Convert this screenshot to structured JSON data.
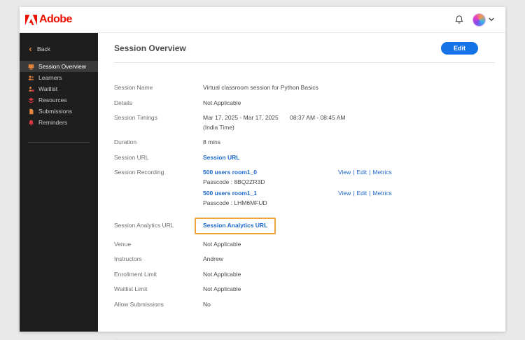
{
  "colors": {
    "adobe_red": "#EB1000",
    "link_blue": "#1B66C9",
    "button_blue": "#1473E6",
    "highlight_orange": "#F2A33C",
    "sidebar_bg": "#1E1E1E",
    "sidebar_active_bg": "#3A3A3A"
  },
  "topbar": {
    "logo_text": "Adobe"
  },
  "sidebar": {
    "back_label": "Back",
    "items": [
      {
        "label": "Session Overview"
      },
      {
        "label": "Learners"
      },
      {
        "label": "Waitlist"
      },
      {
        "label": "Resources"
      },
      {
        "label": "Submissions"
      },
      {
        "label": "Reminders"
      }
    ]
  },
  "main": {
    "title": "Session Overview",
    "edit_button_label": "Edit",
    "fields": {
      "session_name": {
        "label": "Session Name",
        "value": "Virtual classroom session for Python Basics"
      },
      "details": {
        "label": "Details",
        "value": "Not Applicable"
      },
      "session_timings": {
        "label": "Session Timings",
        "dates": "Mar 17, 2025 - Mar 17, 2025",
        "times": "08:37 AM - 08:45 AM",
        "timezone": "(India Time)"
      },
      "duration": {
        "label": "Duration",
        "value": "8 mins"
      },
      "session_url": {
        "label": "Session URL",
        "link_text": "Session URL"
      },
      "session_recording": {
        "label": "Session Recording",
        "separator": "|",
        "items": [
          {
            "link_text": "500 users room1_0",
            "passcode": "Passcode : 8BQ2ZR3D",
            "actions": [
              "View",
              "Edit",
              "Metrics"
            ]
          },
          {
            "link_text": "500 users room1_1",
            "passcode": "Passcode : LHM6MFUD",
            "actions": [
              "View",
              "Edit",
              "Metrics"
            ]
          }
        ]
      },
      "session_analytics": {
        "label": "Session Analytics URL",
        "link_text": "Session Analytics URL"
      },
      "venue": {
        "label": "Venue",
        "value": "Not Applicable"
      },
      "instructors": {
        "label": "Instructors",
        "value": "Andrew"
      },
      "enrollment_limit": {
        "label": "Enrollment Limit",
        "value": "Not Applicable"
      },
      "waitlist_limit": {
        "label": "Waitlist Limit",
        "value": "Not Applicable"
      },
      "allow_submissions": {
        "label": "Allow Submissions",
        "value": "No"
      }
    }
  }
}
